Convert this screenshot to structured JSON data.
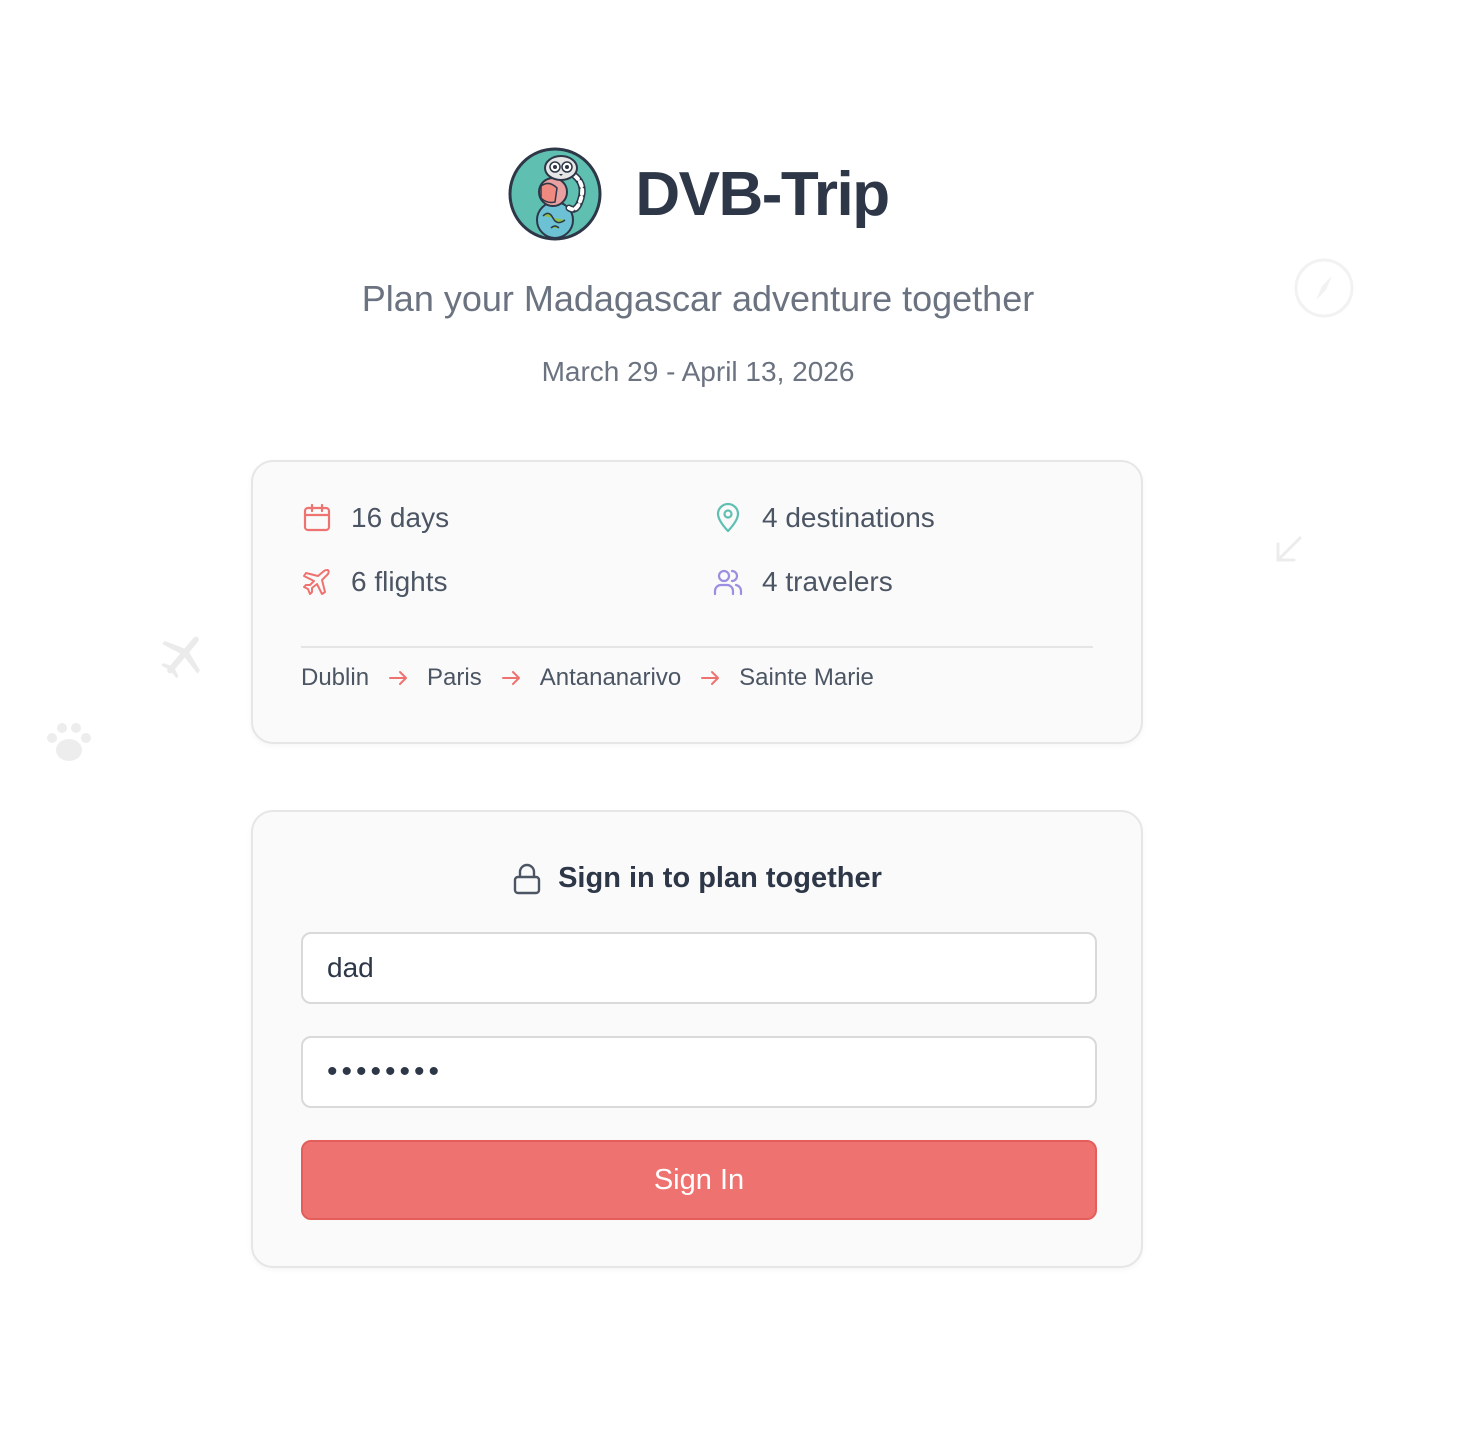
{
  "app": {
    "title": "DVB-Trip",
    "tagline": "Plan your Madagascar adventure together",
    "dates": "March 29 - April 13, 2026"
  },
  "summary": {
    "stats": [
      {
        "icon": "calendar-icon",
        "label": "16 days"
      },
      {
        "icon": "map-pin-icon",
        "label": "4 destinations"
      },
      {
        "icon": "plane-icon",
        "label": "6 flights"
      },
      {
        "icon": "users-icon",
        "label": "4 travelers"
      }
    ],
    "route": [
      "Dublin",
      "Paris",
      "Antananarivo",
      "Sainte Marie"
    ]
  },
  "login": {
    "heading": "Sign in to plan together",
    "username_value": "dad",
    "password_value": "••••••••",
    "submit_label": "Sign In"
  },
  "colors": {
    "accent": "#ee7370",
    "text_dark": "#2d3748",
    "text_muted": "#6b7280",
    "teal": "#5fbfb1",
    "purple": "#9a8fe0"
  }
}
